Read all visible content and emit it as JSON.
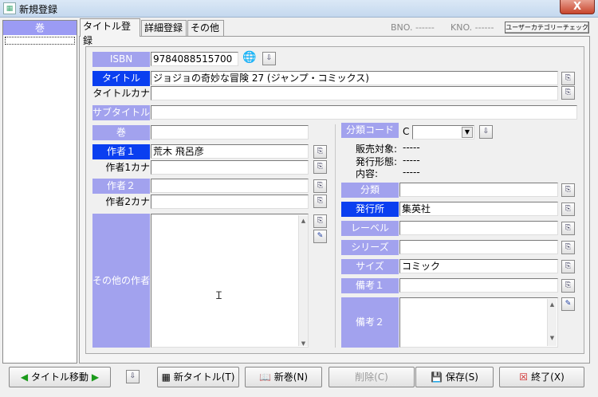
{
  "window": {
    "title": "新規登録",
    "close": "X"
  },
  "sidebar": {
    "header": "巻"
  },
  "tabs": [
    "タイトル登録",
    "詳細登録",
    "その他"
  ],
  "header": {
    "bno": "BNO. ------",
    "kno": "KNO. ------",
    "category_check": "ユーザーカテゴリーチェック"
  },
  "form": {
    "isbn": {
      "label": "ISBN",
      "value": "9784088515700"
    },
    "title": {
      "label": "タイトル",
      "value": "ジョジョの奇妙な冒険 27 (ジャンプ・コミックス)"
    },
    "title_kana": {
      "label": "タイトルカナ",
      "value": ""
    },
    "subtitle": {
      "label": "サブタイトル",
      "value": ""
    },
    "volume": {
      "label": "巻",
      "value": ""
    },
    "author1": {
      "label": "作者１",
      "value": "荒木 飛呂彦"
    },
    "author1_kana": {
      "label": "作者1カナ",
      "value": ""
    },
    "author2": {
      "label": "作者２",
      "value": ""
    },
    "author2_kana": {
      "label": "作者2カナ",
      "value": ""
    },
    "other_authors": {
      "label": "その他の作者",
      "value": ""
    },
    "category_code": {
      "label": "分類コード",
      "prefix": "C",
      "value": ""
    },
    "sales_target": {
      "label": "販売対象:",
      "value": "-----"
    },
    "issue_form": {
      "label": "発行形態:",
      "value": "-----"
    },
    "content": {
      "label": "内容:",
      "value": "-----"
    },
    "category": {
      "label": "分類",
      "value": ""
    },
    "publisher": {
      "label": "発行所",
      "value": "集英社"
    },
    "label_field": {
      "label": "レーベル",
      "value": ""
    },
    "series": {
      "label": "シリーズ",
      "value": ""
    },
    "size": {
      "label": "サイズ",
      "value": "コミック"
    },
    "note1": {
      "label": "備考１",
      "value": ""
    },
    "note2": {
      "label": "備考２",
      "value": ""
    }
  },
  "bottom": {
    "title_move": "タイトル移動",
    "new_title": "新タイトル(T)",
    "new_volume": "新巻(N)",
    "delete": "削除(C)",
    "save": "保存(S)",
    "exit": "終了(X)"
  },
  "colors": {
    "label_bg": "#a2a2ee",
    "label_selected": "#0a3ff0"
  }
}
